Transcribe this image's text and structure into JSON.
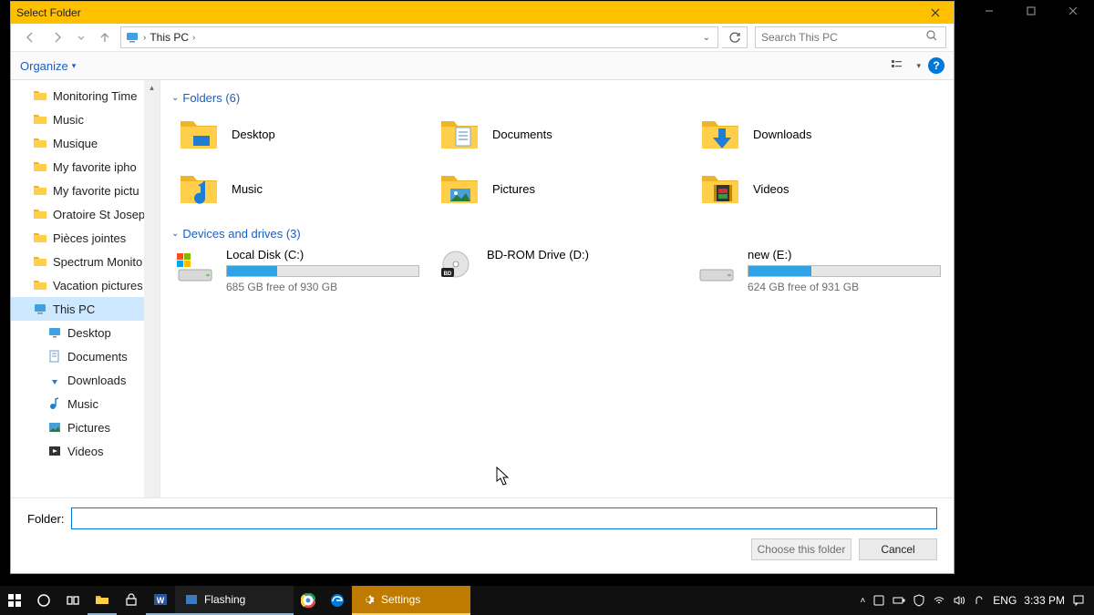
{
  "app_window": {
    "buttons": [
      "minimize",
      "maximize",
      "close"
    ]
  },
  "dialog": {
    "title": "Select Folder",
    "breadcrumb": {
      "root_icon": "this-pc-icon",
      "location": "This PC"
    },
    "search_placeholder": "Search This PC",
    "toolbar": {
      "organize_label": "Organize",
      "help": "?"
    },
    "tree": {
      "items": [
        {
          "label": "Monitoring Time",
          "icon": "folder"
        },
        {
          "label": "Music",
          "icon": "folder"
        },
        {
          "label": "Musique",
          "icon": "folder"
        },
        {
          "label": "My favorite ipho",
          "icon": "folder"
        },
        {
          "label": "My favorite pictu",
          "icon": "folder"
        },
        {
          "label": "Oratoire St Josep",
          "icon": "folder"
        },
        {
          "label": "Pièces jointes",
          "icon": "folder"
        },
        {
          "label": "Spectrum Monito",
          "icon": "folder"
        },
        {
          "label": "Vacation pictures",
          "icon": "folder"
        },
        {
          "label": "This PC",
          "icon": "this-pc",
          "active": true
        },
        {
          "label": "Desktop",
          "icon": "desktop",
          "level": 2
        },
        {
          "label": "Documents",
          "icon": "documents",
          "level": 2
        },
        {
          "label": "Downloads",
          "icon": "downloads",
          "level": 2
        },
        {
          "label": "Music",
          "icon": "music",
          "level": 2
        },
        {
          "label": "Pictures",
          "icon": "pictures",
          "level": 2
        },
        {
          "label": "Videos",
          "icon": "videos",
          "level": 2
        }
      ]
    },
    "content": {
      "folders_header": "Folders (6)",
      "folders": [
        {
          "label": "Desktop",
          "icon": "folder-desktop"
        },
        {
          "label": "Documents",
          "icon": "folder-documents"
        },
        {
          "label": "Downloads",
          "icon": "folder-downloads"
        },
        {
          "label": "Music",
          "icon": "folder-music"
        },
        {
          "label": "Pictures",
          "icon": "folder-pictures"
        },
        {
          "label": "Videos",
          "icon": "folder-videos"
        }
      ],
      "drives_header": "Devices and drives (3)",
      "drives": [
        {
          "label": "Local Disk (C:)",
          "free_text": "685 GB free of 930 GB",
          "fill_pct": 26,
          "icon": "hdd-windows"
        },
        {
          "label": "BD-ROM Drive (D:)",
          "free_text": "",
          "fill_pct": null,
          "icon": "bd-rom"
        },
        {
          "label": "new (E:)",
          "free_text": "624 GB free of 931 GB",
          "fill_pct": 33,
          "icon": "hdd"
        }
      ]
    },
    "folder_label": "Folder:",
    "folder_value": "",
    "choose_btn": "Choose this folder",
    "cancel_btn": "Cancel"
  },
  "taskbar": {
    "apps": [
      {
        "label": "Flashing",
        "icon": "folder-app"
      },
      {
        "label": "Settings",
        "icon": "gear",
        "accent": true
      }
    ],
    "tray": {
      "lang": "ENG",
      "time": "3:33 PM"
    }
  }
}
